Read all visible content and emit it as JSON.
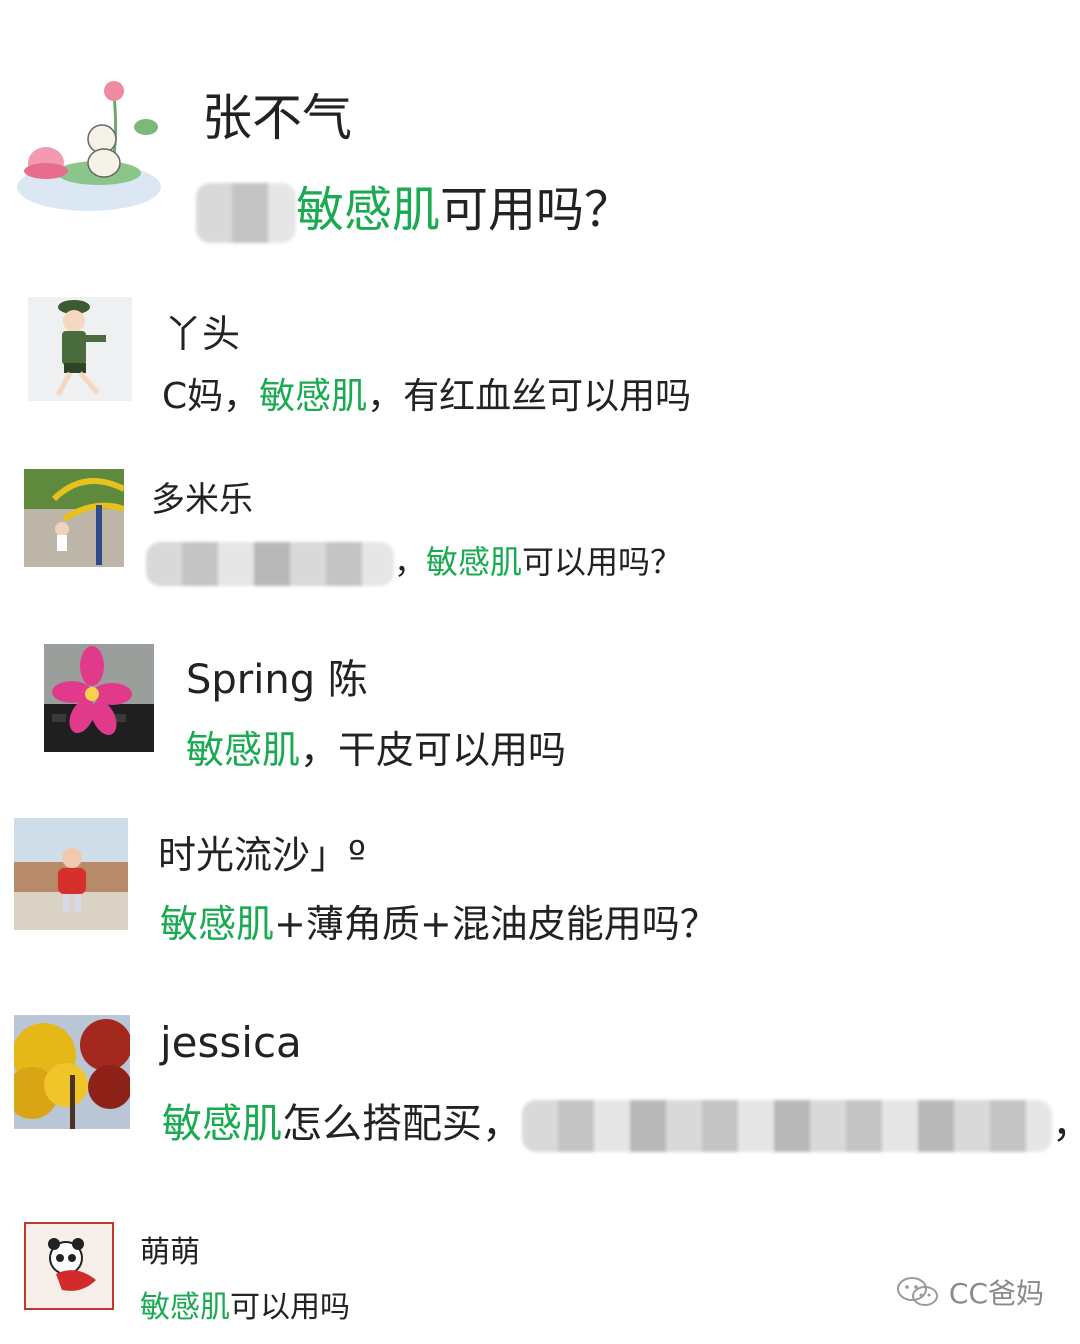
{
  "chat": {
    "messages": [
      {
        "name": "张不气",
        "pre": "",
        "hl": "敏感肌",
        "post": "可用吗？",
        "blur_before": true,
        "blur_after": false
      },
      {
        "name": "丫头",
        "pre": "C妈，",
        "hl": "敏感肌",
        "post": "，有红血丝可以用吗",
        "blur_before": false,
        "blur_after": false
      },
      {
        "name": "多米乐",
        "pre": "，",
        "hl": "敏感肌",
        "post": "可以用吗？",
        "blur_before": true,
        "blur_after": false
      },
      {
        "name": "Spring 陈",
        "pre": "",
        "hl": "敏感肌",
        "post": "，干皮可以用吗",
        "blur_before": false,
        "blur_after": false
      },
      {
        "name": "时光流沙」º",
        "pre": "",
        "hl": "敏感肌",
        "post": "+薄角质+混油皮能用吗？",
        "blur_before": false,
        "blur_after": false
      },
      {
        "name": "jessica",
        "pre": "",
        "hl": "敏感肌",
        "post": "怎么搭配买，",
        "blur_before": false,
        "blur_after": true,
        "tail": "，"
      },
      {
        "name": "萌萌",
        "pre": "",
        "hl": "敏感肌",
        "post": "可以用吗",
        "blur_before": false,
        "blur_after": false
      }
    ]
  },
  "watermark": {
    "text": "CC爸妈",
    "icon": "wechat-icon"
  },
  "colors": {
    "highlight": "#1aab52",
    "text": "#222222",
    "watermark": "#8a8a8a"
  }
}
